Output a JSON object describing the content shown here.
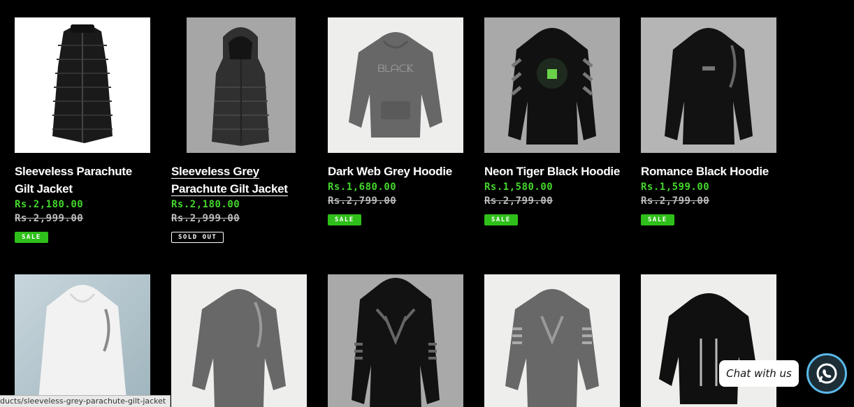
{
  "products": [
    {
      "title": "Sleeveless Parachute Gilt Jacket",
      "price": "Rs.2,180.00",
      "compare": "Rs.2,999.00",
      "badge": "SALE"
    },
    {
      "title": "Sleeveless Grey Parachute Gilt Jacket",
      "price": "Rs.2,180.00",
      "compare": "Rs.2,999.00",
      "badge": "SOLD OUT"
    },
    {
      "title": "Dark Web Grey Hoodie",
      "price": "Rs.1,680.00",
      "compare": "Rs.2,799.00",
      "badge": "SALE"
    },
    {
      "title": "Neon Tiger Black Hoodie",
      "price": "Rs.1,580.00",
      "compare": "Rs.2,799.00",
      "badge": "SALE"
    },
    {
      "title": "Romance Black Hoodie",
      "price": "Rs.1,599.00",
      "compare": "Rs.2,799.00",
      "badge": "SALE"
    }
  ],
  "chat": {
    "label": "Chat with us",
    "icon": "whatsapp-icon"
  },
  "status_url": "ducts/sleeveless-grey-parachute-gilt-jacket",
  "colors": {
    "price_green": "#44d62c",
    "sale_badge": "#2fbf1a",
    "background": "#000000"
  }
}
